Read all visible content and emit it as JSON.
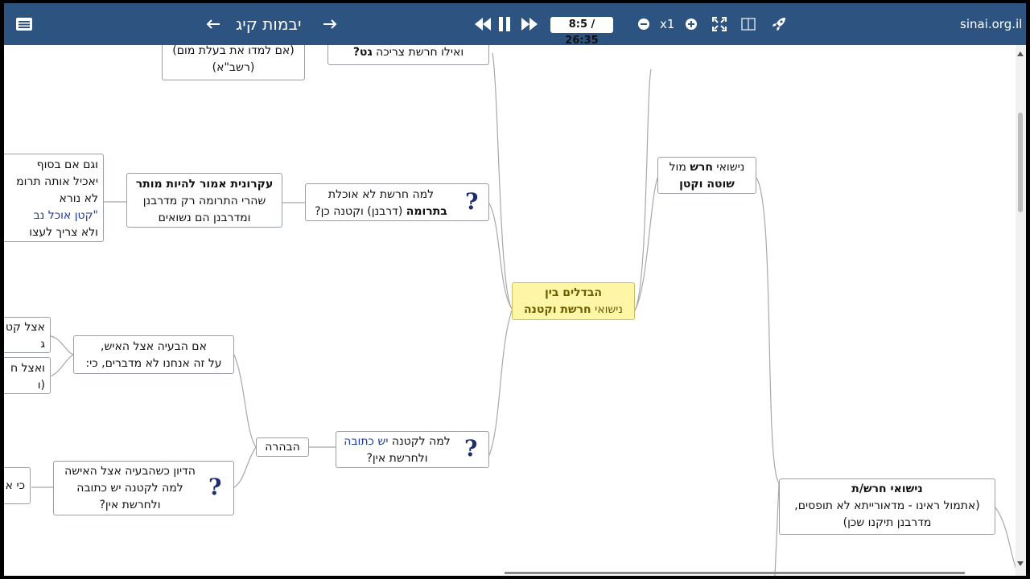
{
  "header": {
    "title": "יבמות קיג",
    "time": "8:5 / 26:35",
    "speed": "x1",
    "site": "sinai.org.il",
    "icons": [
      "menu-icon",
      "arrow-left-icon",
      "arrow-right-icon",
      "rewind-icon",
      "pause-icon",
      "fast-forward-icon",
      "zoom-out-icon",
      "zoom-in-icon",
      "fullscreen-icon",
      "split-view-icon",
      "rocket-icon"
    ]
  },
  "nodes": {
    "top_left": {
      "line1": "(אם למדו את בעלת מום)",
      "line2": "(רשב\"א)"
    },
    "top_mid": {
      "pre": "ואילו חרשת צריכה ",
      "bold": "גט?"
    },
    "left_partial": {
      "line1": "וגם אם בסוף",
      "line2": "יאכיל אותה תרומ",
      "line3": "לא נורא",
      "line4": "\"קטן אוכל נב",
      "line5": "ולא צריך לעצו"
    },
    "barren": {
      "bold": "עקרונית אמור להיות מותר",
      "line2": "שהרי התרומה רק מדרבנן",
      "line3": "ומדרבנן הם נשואים"
    },
    "truma_q": {
      "line1": "למה חרשת לא אוכלת",
      "bold": "בתרומה",
      "line2_rest": " (דרבנן) וקטנה כן?"
    },
    "main": {
      "line1": "הבדלים בין",
      "line2_pre": "נישואי ",
      "line2_bold": "חרשת וקטנה"
    },
    "deaf_vs": {
      "pre": "נישואי ",
      "bold": "חרש",
      "post": " מול",
      "line2": "שוטה וקטן"
    },
    "small1": {
      "line1": "אצל קט",
      "line2": "ג"
    },
    "small2": {
      "line1": "ואצל ח",
      "line2": "(ו"
    },
    "if_issue": {
      "line1": "אם הבעיה אצל האיש,",
      "line2": "על זה אנחנו לא מדברים, כי:"
    },
    "clarify": {
      "text": "הבהרה"
    },
    "ketuba_q": {
      "pre": "למה לקטנה ",
      "blue": "יש כתובה",
      "line2": "ולחרשת אין?"
    },
    "discussion": {
      "line1": "הדיון כשהבעיה אצל האישה",
      "line2": "למה לקטנה יש כתובה",
      "line3": "ולחרשת אין?"
    },
    "ki_partial": {
      "text": "כי א"
    },
    "deaf_marriage": {
      "bold": "נישואי חרש/ת",
      "line2": "(אתמול ראינו - מדאורייתא לא תופסים,",
      "line3": "מדרבנן תיקנו שכן)"
    }
  }
}
